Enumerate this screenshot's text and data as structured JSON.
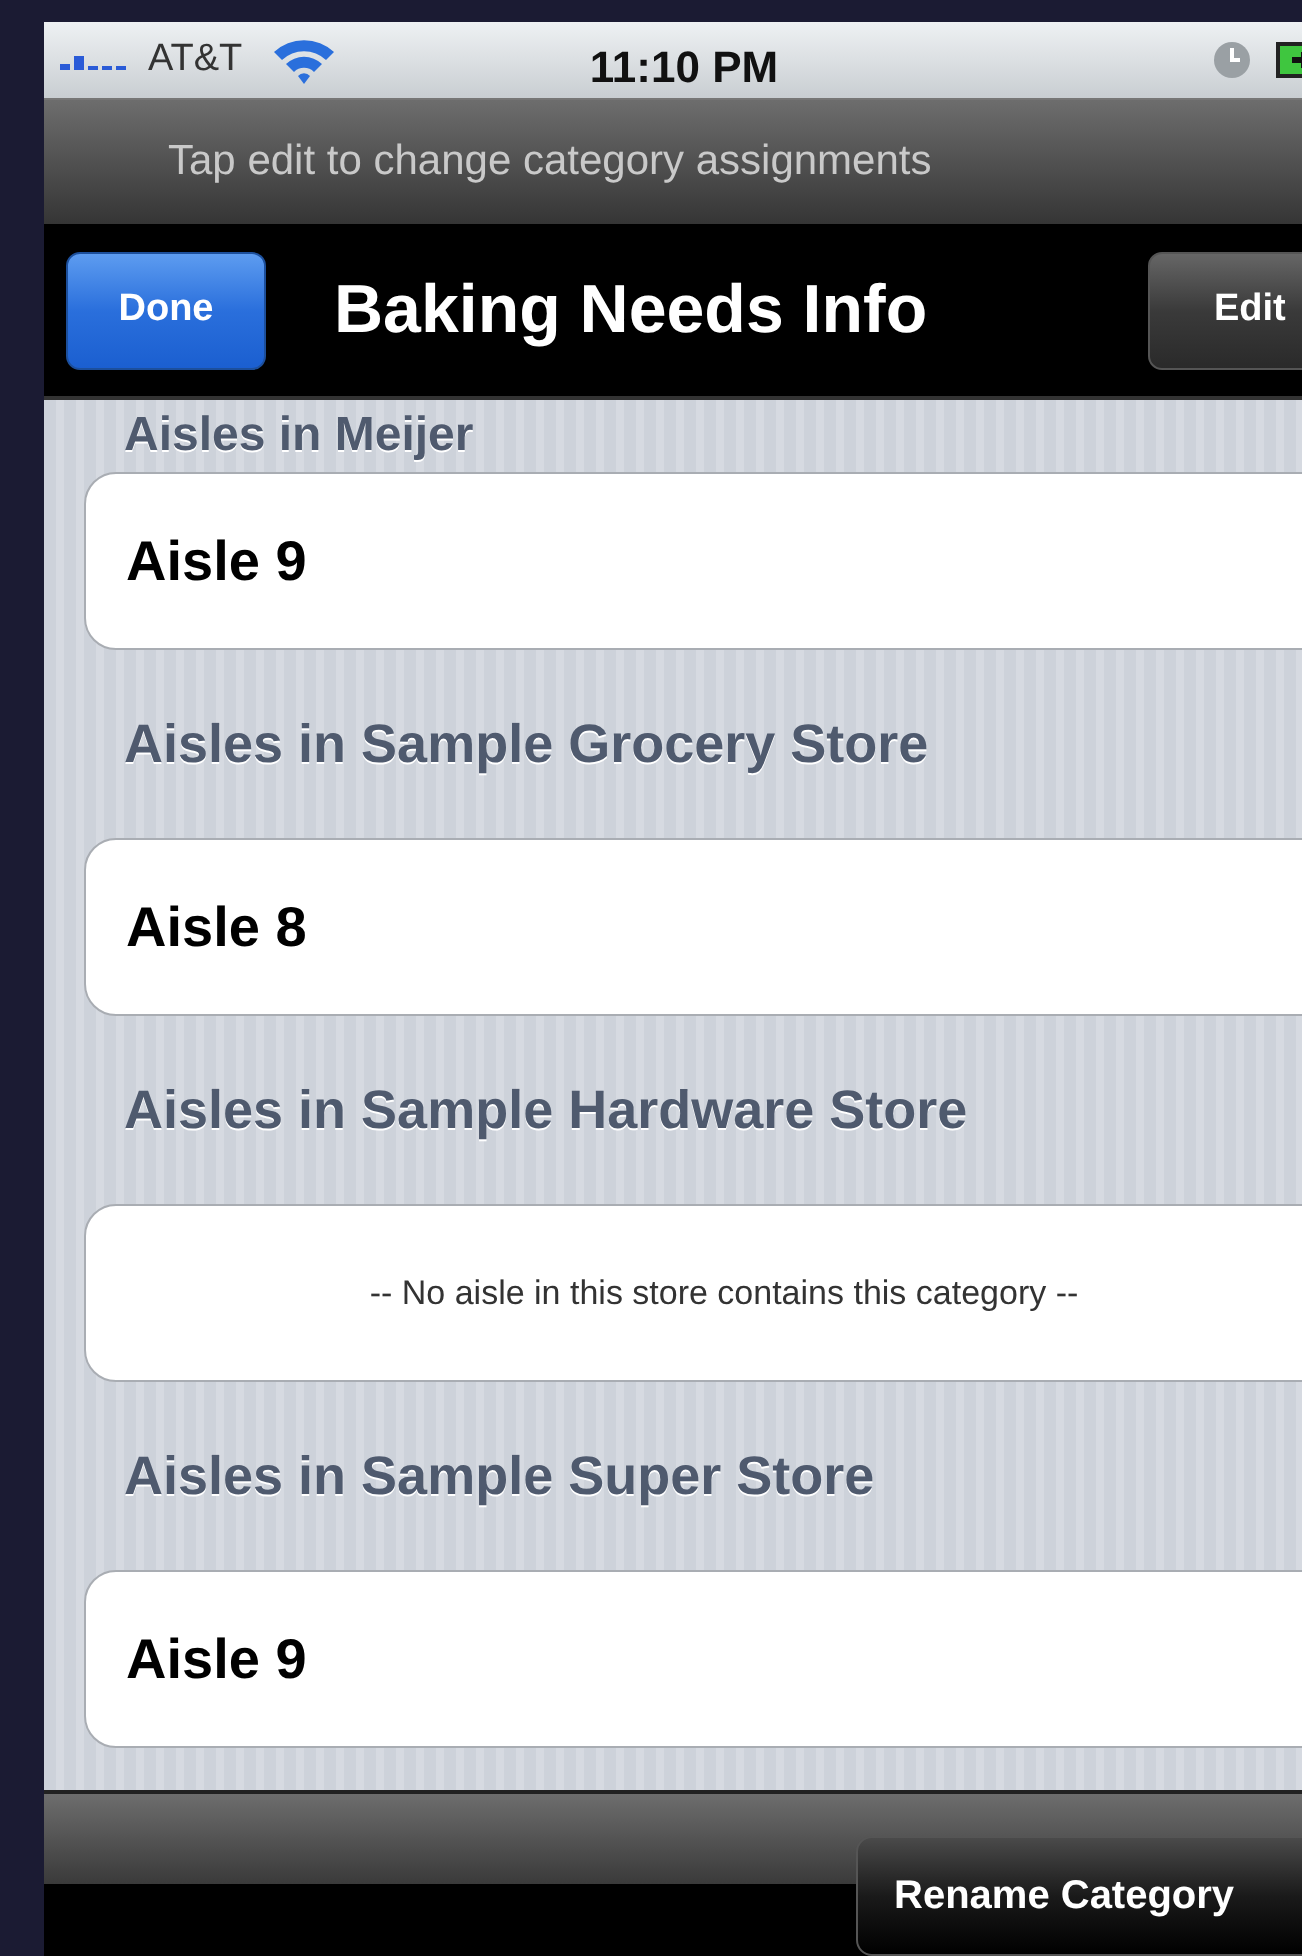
{
  "status_bar": {
    "carrier": "AT&T",
    "time": "11:10 PM"
  },
  "prompt": "Tap edit to change category assignments",
  "nav_bar": {
    "left_button": "Done",
    "title": "Baking Needs Info",
    "right_button": "Edit"
  },
  "sections": [
    {
      "header": "Aisles in Meijer",
      "rows": [
        {
          "kind": "aisle",
          "text": "Aisle 9"
        }
      ]
    },
    {
      "header": "Aisles in Sample Grocery Store",
      "rows": [
        {
          "kind": "aisle",
          "text": "Aisle 8"
        }
      ]
    },
    {
      "header": "Aisles in Sample Hardware Store",
      "rows": [
        {
          "kind": "empty",
          "text": "-- No aisle in this store contains this category --"
        }
      ]
    },
    {
      "header": "Aisles in Sample Super Store",
      "rows": [
        {
          "kind": "aisle",
          "text": "Aisle 9"
        }
      ]
    }
  ],
  "toolbar": {
    "button": "Rename Category"
  }
}
